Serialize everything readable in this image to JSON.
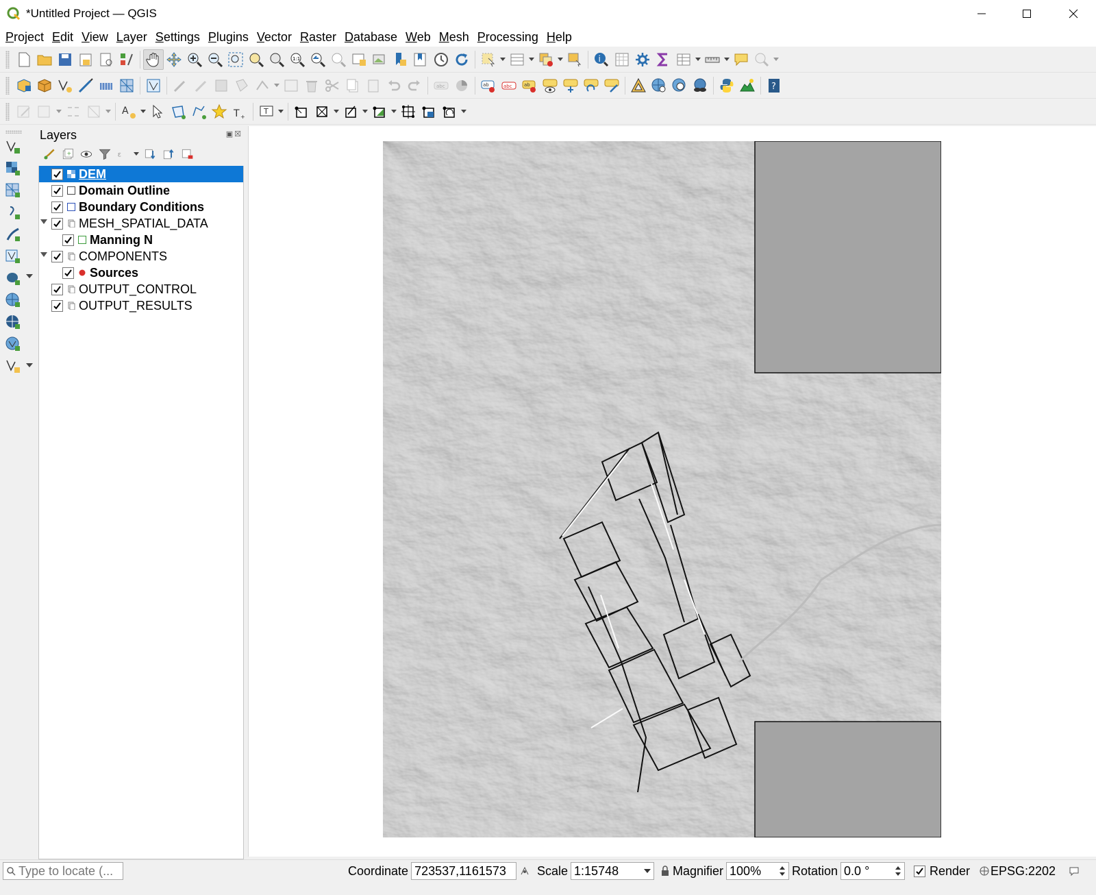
{
  "window": {
    "title": "*Untitled Project — QGIS",
    "logo_color": "#589632"
  },
  "menu": [
    {
      "label": "Project",
      "ul": "P",
      "rest": "roject"
    },
    {
      "label": "Edit",
      "ul": "E",
      "rest": "dit"
    },
    {
      "label": "View",
      "ul": "V",
      "rest": "iew"
    },
    {
      "label": "Layer",
      "ul": "L",
      "rest": "ayer"
    },
    {
      "label": "Settings",
      "ul": "S",
      "rest": "ettings"
    },
    {
      "label": "Plugins",
      "ul": "P",
      "rest": "lugins"
    },
    {
      "label": "Vector",
      "ul": "V",
      "rest": "ector"
    },
    {
      "label": "Raster",
      "ul": "R",
      "rest": "aster"
    },
    {
      "label": "Database",
      "ul": "D",
      "rest": "atabase"
    },
    {
      "label": "Web",
      "ul": "W",
      "rest": "eb"
    },
    {
      "label": "Mesh",
      "ul": "M",
      "rest": "esh"
    },
    {
      "label": "Processing",
      "ul": "P",
      "rest": "rocessing"
    },
    {
      "label": "Help",
      "ul": "H",
      "rest": "elp"
    }
  ],
  "layers_panel": {
    "title": "Layers",
    "items": [
      {
        "name": "DEM",
        "bold": true,
        "selected": true,
        "symbol": "raster-icon"
      },
      {
        "name": "Domain Outline",
        "bold": true,
        "symbol": "polygon-outline-icon"
      },
      {
        "name": "Boundary Conditions",
        "bold": true,
        "symbol": "polygon-blue-icon"
      },
      {
        "name": "MESH_SPATIAL_DATA",
        "bold": false,
        "symbol": "group-icon",
        "expanded": true
      },
      {
        "name": "Manning N",
        "bold": true,
        "symbol": "polygon-green-icon"
      },
      {
        "name": "COMPONENTS",
        "bold": false,
        "symbol": "group-icon",
        "expanded": true
      },
      {
        "name": "Sources",
        "bold": true,
        "symbol": "point-red-icon"
      },
      {
        "name": "OUTPUT_CONTROL",
        "bold": false,
        "symbol": "group-icon"
      },
      {
        "name": "OUTPUT_RESULTS",
        "bold": false,
        "symbol": "group-icon"
      }
    ]
  },
  "statusbar": {
    "locate_placeholder": "Type to locate (...",
    "coordinate_label": "Coordinate",
    "coordinate_value": "723537,1161573",
    "scale_label": "Scale",
    "scale_value": "1:15748",
    "magnifier_label": "Magnifier",
    "magnifier_value": "100%",
    "rotation_label": "Rotation",
    "rotation_value": "0.0 °",
    "render_label": "Render",
    "render_checked": true,
    "crs_label": "EPSG:2202"
  },
  "colors": {
    "selection": "#0e78d6",
    "hillshade": "#a9a9a9",
    "domain_mask": "#a4a4a4"
  }
}
